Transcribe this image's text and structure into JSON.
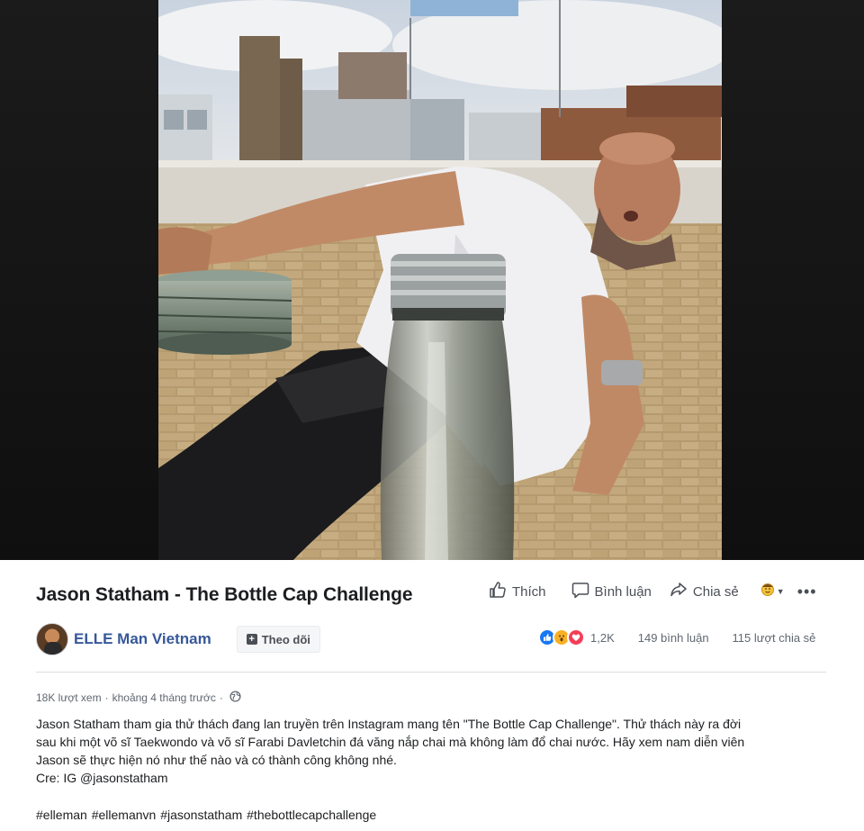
{
  "video": {
    "description_alt": ""
  },
  "post": {
    "title": "Jason Statham - The Bottle Cap Challenge",
    "actions": {
      "like": "Thích",
      "comment": "Bình luận",
      "share": "Chia sẻ"
    },
    "page": {
      "name": "ELLE Man Vietnam",
      "follow_label": "Theo dõi"
    },
    "stats": {
      "reactions": "1,2K",
      "comments": "149 bình luận",
      "shares": "115 lượt chia sẻ"
    },
    "meta": {
      "views": "18K lượt xem",
      "time": "khoảng 4 tháng trước"
    },
    "description": {
      "line1": "Jason Statham tham gia thử thách đang lan truyền trên Instagram mang tên \"The Bottle Cap Challenge\". Thử thách này ra đời",
      "line2": "sau khi một võ sĩ Taekwondo và võ sĩ Farabi Davletchin đá văng nắp chai mà không làm đổ chai nước. Hãy xem nam diễn viên",
      "line3": "Jason sẽ thực hiện nó như thế nào và có thành công không nhé.",
      "line4": "Cre: IG @jasonstatham"
    },
    "hashtags": "#elleman #ellemanvn #jasonstatham #thebottlecapchallenge"
  },
  "colors": {
    "link": "#365899",
    "text": "#1c1e21",
    "secondary": "#606770",
    "like_blue": "#1877f2",
    "wow_yellow": "#f7b125",
    "love_red": "#f33e58"
  },
  "icons": [
    "thumbs-up-icon",
    "comment-icon",
    "share-arrow-icon",
    "audience-icon",
    "more-icon",
    "globe-icon",
    "plus-icon"
  ]
}
